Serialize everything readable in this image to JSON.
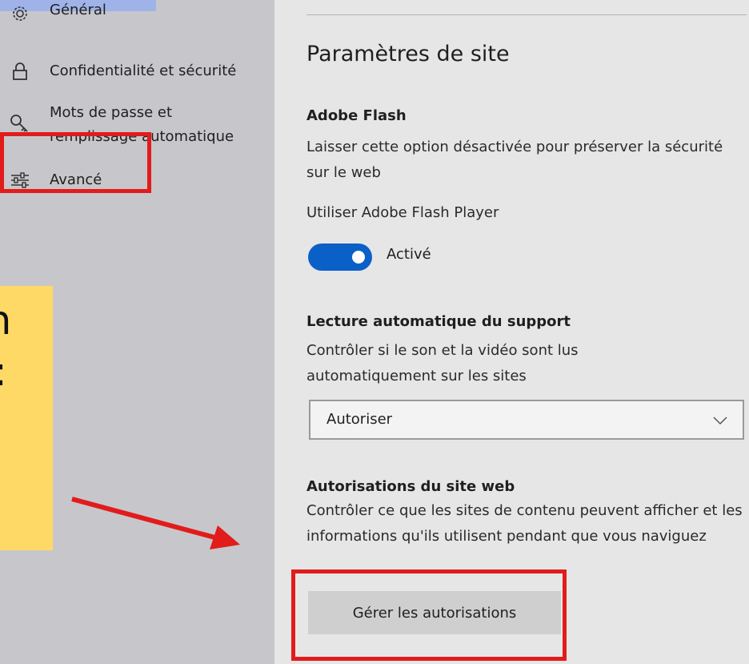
{
  "sidebar": {
    "items": [
      {
        "label": "Général",
        "icon": "gear-icon"
      },
      {
        "label": "Confidentialité et sécurité",
        "icon": "lock-icon"
      },
      {
        "label_line1": "Mots de passe et",
        "label_line2": "remplissage automatique",
        "icon": "key-icon"
      },
      {
        "label": "Avancé",
        "icon": "sliders-icon"
      }
    ]
  },
  "callout": {
    "text_line1": "on",
    "text_line2": ":"
  },
  "main": {
    "title": "Paramètres de site",
    "flash": {
      "title": "Adobe Flash",
      "desc": "Laisser cette option désactivée pour préserver la sécurité sur le web",
      "toggle_caption": "Utiliser Adobe Flash Player",
      "toggle_state": "Activé"
    },
    "autoplay": {
      "title": "Lecture automatique du support",
      "desc": "Contrôler si le son et la vidéo sont lus automatiquement sur les sites",
      "selected": "Autoriser"
    },
    "permissions": {
      "title": "Autorisations du site web",
      "desc": "Contrôler ce que les sites de contenu peuvent afficher et les informations qu'ils utilisent pendant que vous naviguez",
      "button": "Gérer les autorisations"
    }
  },
  "colors": {
    "accent": "#0b60c8",
    "highlight": "#e21b1b",
    "callout": "#ffd966"
  }
}
